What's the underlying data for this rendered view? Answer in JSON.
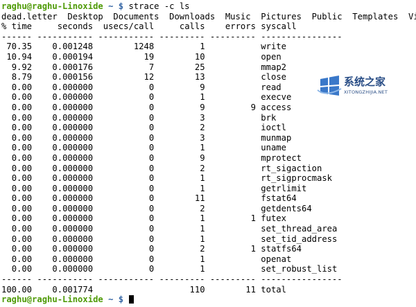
{
  "prompt": {
    "user_host": "raghu@raghu-Linoxide",
    "path": "~",
    "symbol": "$",
    "command": "strace -c ls"
  },
  "ls_output": "dead.letter  Desktop  Documents  Downloads  Music  Pictures  Public  Templates  Videos",
  "header": {
    "time": "% time",
    "seconds": "seconds",
    "usecs_call": "usecs/call",
    "calls": "calls",
    "errors": "errors",
    "syscall": "syscall"
  },
  "separator": "------ ----------- ----------- --------- --------- ----------------",
  "rows": [
    {
      "time": "70.35",
      "seconds": "0.001248",
      "usecs": "1248",
      "calls": "1",
      "errors": "",
      "syscall": "write"
    },
    {
      "time": "10.94",
      "seconds": "0.000194",
      "usecs": "19",
      "calls": "10",
      "errors": "",
      "syscall": "open"
    },
    {
      "time": "9.92",
      "seconds": "0.000176",
      "usecs": "7",
      "calls": "25",
      "errors": "",
      "syscall": "mmap2"
    },
    {
      "time": "8.79",
      "seconds": "0.000156",
      "usecs": "12",
      "calls": "13",
      "errors": "",
      "syscall": "close"
    },
    {
      "time": "0.00",
      "seconds": "0.000000",
      "usecs": "0",
      "calls": "9",
      "errors": "",
      "syscall": "read"
    },
    {
      "time": "0.00",
      "seconds": "0.000000",
      "usecs": "0",
      "calls": "1",
      "errors": "",
      "syscall": "execve"
    },
    {
      "time": "0.00",
      "seconds": "0.000000",
      "usecs": "0",
      "calls": "9",
      "errors": "9",
      "syscall": "access"
    },
    {
      "time": "0.00",
      "seconds": "0.000000",
      "usecs": "0",
      "calls": "3",
      "errors": "",
      "syscall": "brk"
    },
    {
      "time": "0.00",
      "seconds": "0.000000",
      "usecs": "0",
      "calls": "2",
      "errors": "",
      "syscall": "ioctl"
    },
    {
      "time": "0.00",
      "seconds": "0.000000",
      "usecs": "0",
      "calls": "3",
      "errors": "",
      "syscall": "munmap"
    },
    {
      "time": "0.00",
      "seconds": "0.000000",
      "usecs": "0",
      "calls": "1",
      "errors": "",
      "syscall": "uname"
    },
    {
      "time": "0.00",
      "seconds": "0.000000",
      "usecs": "0",
      "calls": "9",
      "errors": "",
      "syscall": "mprotect"
    },
    {
      "time": "0.00",
      "seconds": "0.000000",
      "usecs": "0",
      "calls": "2",
      "errors": "",
      "syscall": "rt_sigaction"
    },
    {
      "time": "0.00",
      "seconds": "0.000000",
      "usecs": "0",
      "calls": "1",
      "errors": "",
      "syscall": "rt_sigprocmask"
    },
    {
      "time": "0.00",
      "seconds": "0.000000",
      "usecs": "0",
      "calls": "1",
      "errors": "",
      "syscall": "getrlimit"
    },
    {
      "time": "0.00",
      "seconds": "0.000000",
      "usecs": "0",
      "calls": "11",
      "errors": "",
      "syscall": "fstat64"
    },
    {
      "time": "0.00",
      "seconds": "0.000000",
      "usecs": "0",
      "calls": "2",
      "errors": "",
      "syscall": "getdents64"
    },
    {
      "time": "0.00",
      "seconds": "0.000000",
      "usecs": "0",
      "calls": "1",
      "errors": "1",
      "syscall": "futex"
    },
    {
      "time": "0.00",
      "seconds": "0.000000",
      "usecs": "0",
      "calls": "1",
      "errors": "",
      "syscall": "set_thread_area"
    },
    {
      "time": "0.00",
      "seconds": "0.000000",
      "usecs": "0",
      "calls": "1",
      "errors": "",
      "syscall": "set_tid_address"
    },
    {
      "time": "0.00",
      "seconds": "0.000000",
      "usecs": "0",
      "calls": "2",
      "errors": "1",
      "syscall": "statfs64"
    },
    {
      "time": "0.00",
      "seconds": "0.000000",
      "usecs": "0",
      "calls": "1",
      "errors": "",
      "syscall": "openat"
    },
    {
      "time": "0.00",
      "seconds": "0.000000",
      "usecs": "0",
      "calls": "1",
      "errors": "",
      "syscall": "set_robust_list"
    }
  ],
  "total": {
    "time": "100.00",
    "seconds": "0.001774",
    "usecs": "",
    "calls": "110",
    "errors": "11",
    "syscall": "total"
  },
  "watermark": {
    "title": "系统之家",
    "subtitle": "XITONGZHIJIA.NET",
    "icon": "windows-flag-icon"
  },
  "colors": {
    "prompt_user": "#4e9a06",
    "prompt_path": "#3465a4",
    "text": "#000000",
    "background": "#ffffff",
    "watermark": "#2a4e86"
  }
}
